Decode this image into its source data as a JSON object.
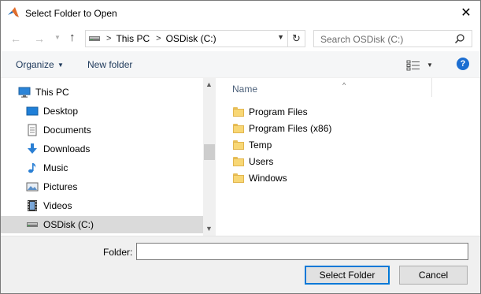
{
  "window": {
    "title": "Select Folder to Open",
    "close_glyph": "✕"
  },
  "nav": {
    "back_glyph": "←",
    "forward_glyph": "→",
    "recent_glyph": "▼",
    "up_glyph": "↑"
  },
  "address": {
    "separator": ">",
    "segments": [
      "This PC",
      "OSDisk (C:)"
    ],
    "dropdown_glyph": "▼",
    "refresh_glyph": "↻"
  },
  "search": {
    "placeholder": "Search OSDisk (C:)"
  },
  "toolbar": {
    "organize_label": "Organize",
    "organize_dropdown": "▼",
    "new_folder_label": "New folder",
    "view_dropdown": "▼",
    "help_glyph": "?"
  },
  "tree": {
    "items": [
      {
        "label": "This PC",
        "icon": "computer-icon"
      },
      {
        "label": "Desktop",
        "icon": "desktop-icon"
      },
      {
        "label": "Documents",
        "icon": "documents-icon"
      },
      {
        "label": "Downloads",
        "icon": "downloads-icon"
      },
      {
        "label": "Music",
        "icon": "music-icon"
      },
      {
        "label": "Pictures",
        "icon": "pictures-icon"
      },
      {
        "label": "Videos",
        "icon": "videos-icon"
      },
      {
        "label": "OSDisk (C:)",
        "icon": "drive-icon",
        "selected": true
      }
    ]
  },
  "scrollbar": {
    "up_glyph": "▲",
    "down_glyph": "▼"
  },
  "list": {
    "column_name": "Name",
    "sort_glyph": "^",
    "items": [
      "Program Files",
      "Program Files (x86)",
      "Temp",
      "Users",
      "Windows"
    ]
  },
  "footer": {
    "folder_label": "Folder:",
    "folder_value": "",
    "select_button": "Select Folder",
    "cancel_button": "Cancel"
  },
  "colors": {
    "accent": "#0078d7",
    "selection": "#dadada",
    "folder": "#f8d775",
    "link_text": "#1e395b",
    "help": "#1c6ed1"
  }
}
